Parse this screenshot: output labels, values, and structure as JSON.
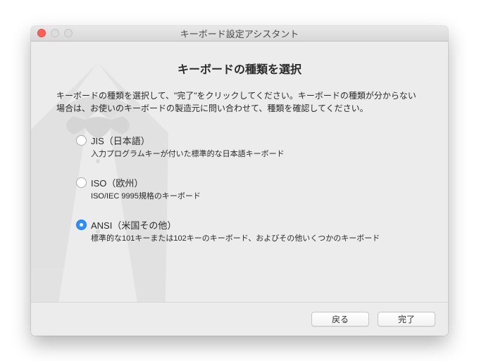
{
  "window": {
    "title": "キーボード設定アシスタント"
  },
  "heading": "キーボードの種類を選択",
  "intro": "キーボードの種類を選択して、\"完了\"をクリックしてください。キーボードの種類が分からない場合は、お使いのキーボードの製造元に問い合わせて、種類を確認してください。",
  "options": [
    {
      "label": "JIS（日本語）",
      "desc": "入力プログラムキーが付いた標準的な日本語キーボード",
      "checked": false
    },
    {
      "label": "ISO（欧州）",
      "desc": "ISO/IEC 9995規格のキーボード",
      "checked": false
    },
    {
      "label": "ANSI（米国その他）",
      "desc": "標準的な101キーまたは102キーのキーボード、およびその他いくつかのキーボード",
      "checked": true
    }
  ],
  "buttons": {
    "back": "戻る",
    "done": "完了"
  }
}
